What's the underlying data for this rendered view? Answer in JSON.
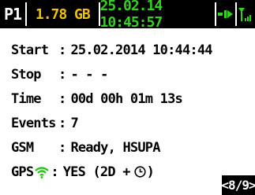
{
  "status_bar": {
    "profile": "P1",
    "storage": "1.78 GB",
    "datetime": "25.02.14 10:45:57",
    "colors": {
      "background": "#000000",
      "profile": "#ffffff",
      "storage": "#f2c200",
      "datetime": "#32d21e"
    },
    "icons": [
      "record-icon",
      "antenna-signal-icon"
    ]
  },
  "info": {
    "start": {
      "label": "Start",
      "value": "25.02.2014 10:44:44"
    },
    "stop": {
      "label": "Stop",
      "value": "- - -"
    },
    "time": {
      "label": "Time",
      "value": "00d 00h 01m 13s"
    },
    "events": {
      "label": "Events",
      "value": "7"
    },
    "gsm": {
      "label": "GSM",
      "value": "Ready, HSUPA"
    },
    "gps": {
      "label": "GPS",
      "value_prefix": "YES (2D +",
      "value_suffix": ")",
      "icons": [
        "wifi-icon",
        "clock-icon"
      ]
    }
  },
  "page_indicator": "<8/9>"
}
